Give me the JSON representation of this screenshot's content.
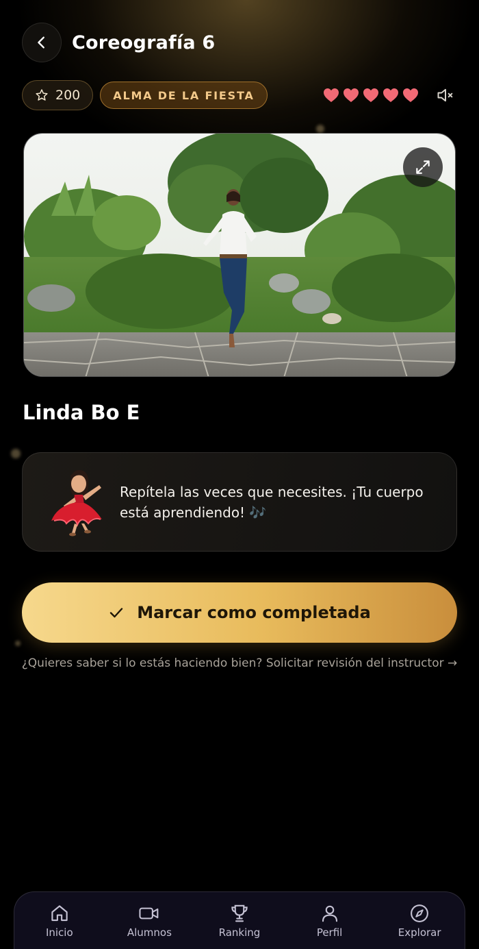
{
  "header": {
    "back_icon": "chevron-left-icon",
    "title": "Coreografía 6"
  },
  "stats": {
    "xp_icon": "star-icon",
    "xp_value": "200",
    "badge_label": "ALMA DE LA FIESTA",
    "hearts": 5,
    "heart_color": "#f26a75",
    "mute_icon": "volume-mute-icon"
  },
  "video": {
    "expand_icon": "expand-icon"
  },
  "lesson": {
    "title": "Linda Bo E"
  },
  "tip": {
    "mascot": "dancer-mascot",
    "text": "Repítela las veces que necesites. ¡Tu cuerpo está aprendiendo! 🎶"
  },
  "actions": {
    "complete_icon": "check-icon",
    "complete_label": "Marcar como completada",
    "review_link": "¿Quieres saber si lo estás haciendo bien? Solicitar revisión del instructor →"
  },
  "nav": {
    "items": [
      {
        "label": "Inicio",
        "icon": "home-icon"
      },
      {
        "label": "Alumnos",
        "icon": "video-icon"
      },
      {
        "label": "Ranking",
        "icon": "trophy-icon"
      },
      {
        "label": "Perfil",
        "icon": "user-icon"
      },
      {
        "label": "Explorar",
        "icon": "compass-icon"
      }
    ]
  },
  "colors": {
    "accent_gold": "#e8bb5c",
    "background": "#000000"
  }
}
